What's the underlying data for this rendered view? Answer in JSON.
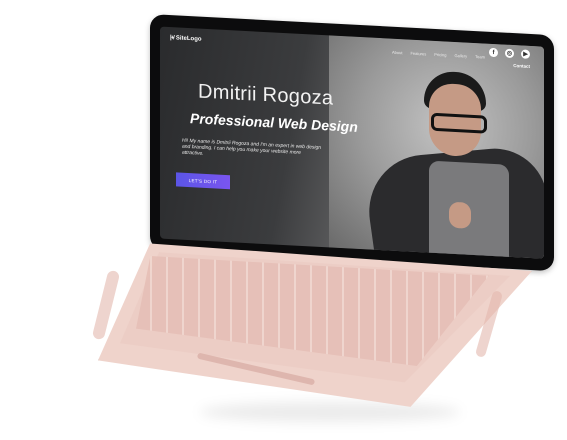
{
  "site": {
    "logo_text": "SiteLogo",
    "logo_mark": "|+/",
    "nav": [
      "About",
      "Features",
      "Pricing",
      "Gallery",
      "Team"
    ],
    "contact": "Contact",
    "social_icons": [
      "facebook-icon",
      "instagram-icon",
      "youtube-icon"
    ]
  },
  "hero": {
    "name": "Dmitrii Rogoza",
    "title": "Professional Web Design",
    "description": "Hi! My name is Dmitrii Rogoza and I'm an expert in web design and branding. I can help you make your website more attractive.",
    "cta": "LET'S DO IT"
  },
  "colors": {
    "cta_start": "#5b55e6",
    "cta_end": "#7a55f0",
    "laptop_body": "#efd3cb",
    "bezel": "#0c0c0d"
  }
}
